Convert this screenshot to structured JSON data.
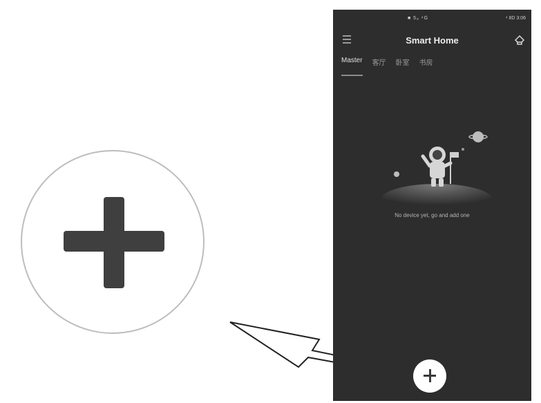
{
  "status_bar": {
    "center": "■ 5ₐ ⁴G",
    "right": "⁴ 8D 3:06"
  },
  "header": {
    "title": "Smart Home"
  },
  "tabs": [
    {
      "label": "Master",
      "active": true
    },
    {
      "label": "客厅",
      "active": false
    },
    {
      "label": "卧室",
      "active": false
    },
    {
      "label": "书房",
      "active": false
    }
  ],
  "empty_state": {
    "message": "No device yet, go and add one"
  },
  "icons": {
    "menu": "menu-icon",
    "home": "home-icon",
    "add": "plus-icon",
    "zoom_add": "plus-icon-magnified",
    "arrow": "callout-arrow"
  },
  "colors": {
    "phone_background": "#2d2d2d",
    "plus_dark": "#3f3f3f",
    "add_button": "#ffffff"
  }
}
